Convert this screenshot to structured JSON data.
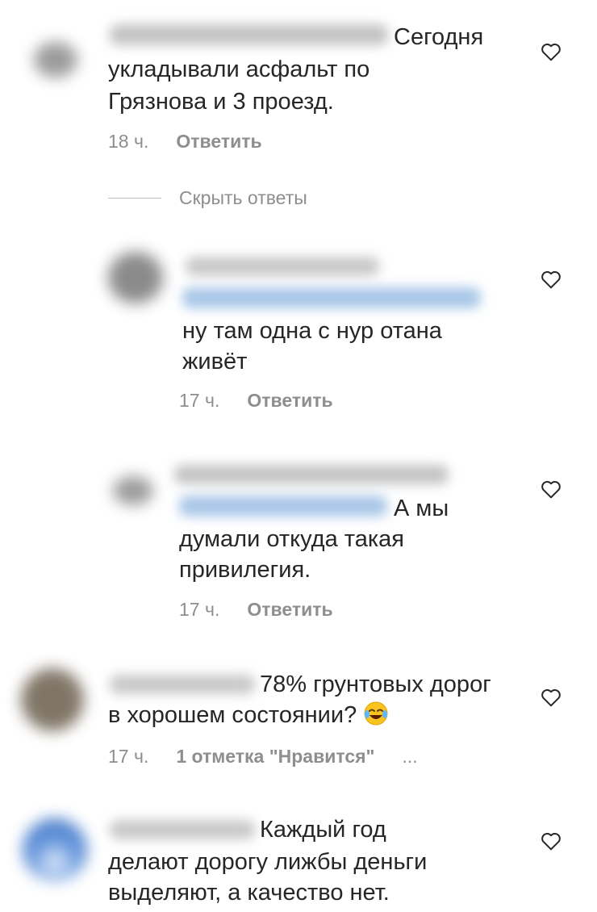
{
  "comments": [
    {
      "text_lines": [
        "Сегодня",
        "укладывали асфальт по",
        "Грязнова и 3 проезд."
      ],
      "time": "18 ч.",
      "reply_label": "Ответить"
    },
    {
      "text_lines": [
        "ну там одна с нур отана",
        "живёт"
      ],
      "time": "17 ч.",
      "reply_label": "Ответить"
    },
    {
      "text_lines": [
        "А мы",
        "думали откуда такая",
        "привилегия."
      ],
      "time": "17 ч.",
      "reply_label": "Ответить"
    },
    {
      "text_lines": [
        "78% грунтовых дорог",
        "в хорошем состоянии?"
      ],
      "time": "17 ч.",
      "likes_label": "1 отметка \"Нравится\"",
      "more_label": "..."
    },
    {
      "text_lines": [
        "Каждый год",
        "делают дорогу лижбы деньги",
        "выделяют, а качество нет."
      ]
    }
  ],
  "hide_replies_label": "Скрыть ответы",
  "colors": {
    "text": "#262626",
    "secondary": "#8e8e8e",
    "mention_blur": "#a9c7e8",
    "username_blur": "#c9c9c9"
  },
  "icons": [
    "heart-icon",
    "laughing-emoji-icon"
  ]
}
